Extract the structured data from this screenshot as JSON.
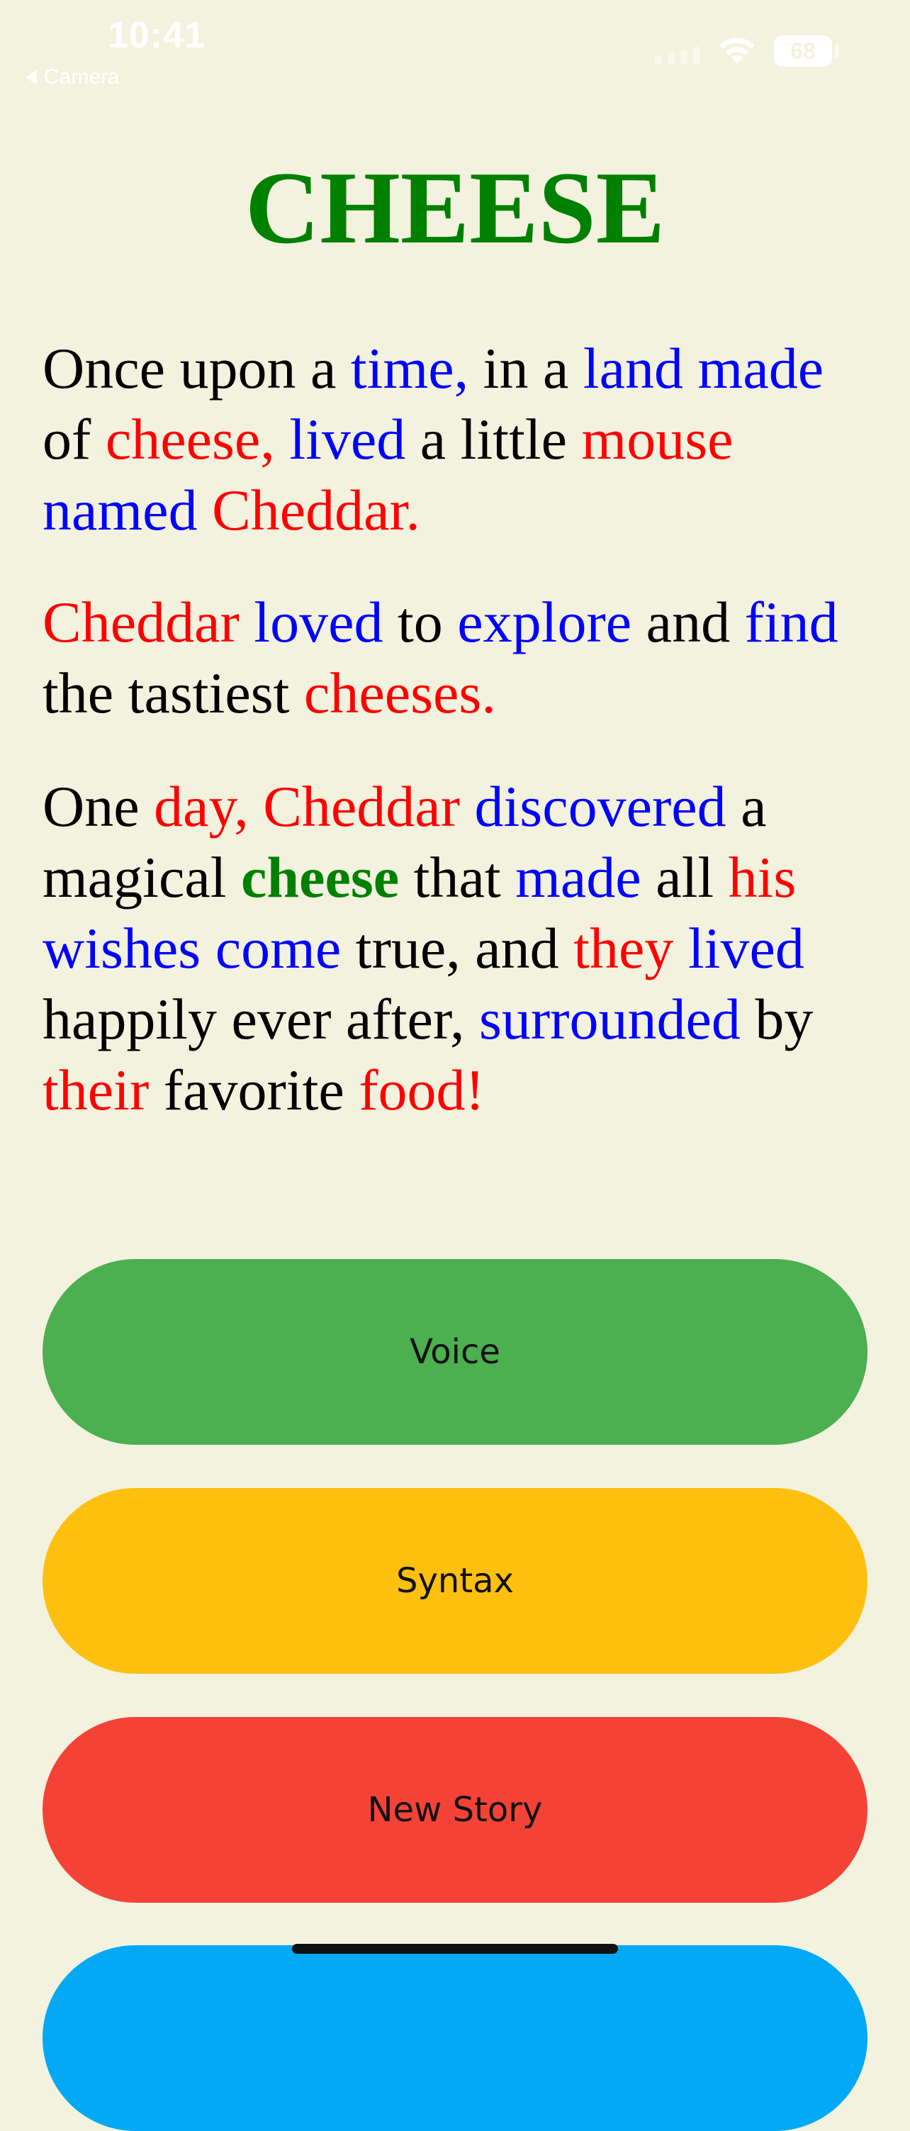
{
  "status_bar": {
    "time": "10:41",
    "back_label": "Camera",
    "battery": "68",
    "icons": [
      "signal-icon",
      "wifi-icon",
      "battery-icon",
      "back-arrow-icon"
    ]
  },
  "title": "CHEESE",
  "story": {
    "paragraphs": [
      [
        {
          "t": "Once upon a ",
          "c": "plain"
        },
        {
          "t": "time,",
          "c": "blue"
        },
        {
          "t": " in a ",
          "c": "plain"
        },
        {
          "t": "land",
          "c": "blue"
        },
        {
          "t": " ",
          "c": "plain"
        },
        {
          "t": "made",
          "c": "blue"
        },
        {
          "t": " of ",
          "c": "plain"
        },
        {
          "t": "cheese,",
          "c": "red"
        },
        {
          "t": " ",
          "c": "plain"
        },
        {
          "t": "lived",
          "c": "blue"
        },
        {
          "t": " a little ",
          "c": "plain"
        },
        {
          "t": "mouse",
          "c": "red"
        },
        {
          "t": " ",
          "c": "plain"
        },
        {
          "t": "named",
          "c": "blue"
        },
        {
          "t": " ",
          "c": "plain"
        },
        {
          "t": "Cheddar.",
          "c": "red"
        }
      ],
      [
        {
          "t": "Cheddar",
          "c": "red"
        },
        {
          "t": " ",
          "c": "plain"
        },
        {
          "t": "loved",
          "c": "blue"
        },
        {
          "t": " to ",
          "c": "plain"
        },
        {
          "t": "explore",
          "c": "blue"
        },
        {
          "t": " and ",
          "c": "plain"
        },
        {
          "t": "find",
          "c": "blue"
        },
        {
          "t": " the tastiest ",
          "c": "plain"
        },
        {
          "t": "cheeses.",
          "c": "red"
        }
      ],
      [
        {
          "t": "One ",
          "c": "plain"
        },
        {
          "t": "day,",
          "c": "red"
        },
        {
          "t": " ",
          "c": "plain"
        },
        {
          "t": "Cheddar",
          "c": "red"
        },
        {
          "t": " ",
          "c": "plain"
        },
        {
          "t": "discovered",
          "c": "blue"
        },
        {
          "t": " a magical ",
          "c": "plain"
        },
        {
          "t": "cheese",
          "c": "green"
        },
        {
          "t": " that ",
          "c": "plain"
        },
        {
          "t": "made",
          "c": "blue"
        },
        {
          "t": " all ",
          "c": "plain"
        },
        {
          "t": "his",
          "c": "red"
        },
        {
          "t": " ",
          "c": "plain"
        },
        {
          "t": "wishes",
          "c": "blue"
        },
        {
          "t": " ",
          "c": "plain"
        },
        {
          "t": "come",
          "c": "blue"
        },
        {
          "t": " true, and ",
          "c": "plain"
        },
        {
          "t": "they",
          "c": "red"
        },
        {
          "t": " ",
          "c": "plain"
        },
        {
          "t": "lived",
          "c": "blue"
        },
        {
          "t": " happily ever after, ",
          "c": "plain"
        },
        {
          "t": "surrounded",
          "c": "blue"
        },
        {
          "t": " by ",
          "c": "plain"
        },
        {
          "t": "their",
          "c": "red"
        },
        {
          "t": " favorite ",
          "c": "plain"
        },
        {
          "t": "food!",
          "c": "red"
        }
      ]
    ],
    "colors": {
      "plain": "#000000",
      "blue": "#0000ff",
      "red": "#ff0000",
      "green": "#008000",
      "title": "#008000",
      "background": "#f3f2df"
    }
  },
  "buttons": {
    "voice": {
      "label": "Voice",
      "color": "#4caf50"
    },
    "syntax": {
      "label": "Syntax",
      "color": "#fdc00f"
    },
    "new_story": {
      "label": "New Story",
      "color": "#f44336"
    },
    "partial": {
      "label": "",
      "color": "#03a9f4"
    }
  }
}
